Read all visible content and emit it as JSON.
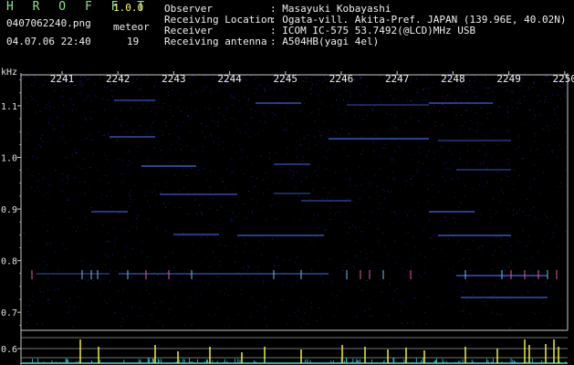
{
  "app": {
    "title": "H R O F F T",
    "version": "1.0.0",
    "filename": "0407062240.png",
    "datetime": "04.07.06 22:40",
    "meteor_label": "meteor",
    "meteor_count": "19"
  },
  "info": [
    {
      "key": "Observer",
      "value": ": Masayuki Kobayashi"
    },
    {
      "key": "Receiving Location",
      "value": ": Ogata-vill. Akita-Pref. JAPAN (139.96E, 40.02N)"
    },
    {
      "key": "Receiver",
      "value": ": ICOM IC-575 53.7492(@LCD)MHz USB"
    },
    {
      "key": "Receiving antenna",
      "value": ": A504HB(yagi 4el)"
    }
  ],
  "chart_data": {
    "type": "heatmap",
    "ylabel": "kHz",
    "y_ticks": [
      "1.1",
      "1.0",
      "0.9",
      "0.8",
      "0.7",
      "0.6"
    ],
    "x_ticks": [
      "2241",
      "2242",
      "2243",
      "2244",
      "2245",
      "2246",
      "2247",
      "2248",
      "2249",
      "2250"
    ],
    "colors": {
      "background": "#000000",
      "noise": "#1a2a9a",
      "echo": "#4a70ff",
      "axis": "#c8c8c8",
      "bars": "#ffff33",
      "baseline": "#30d0d0"
    }
  }
}
